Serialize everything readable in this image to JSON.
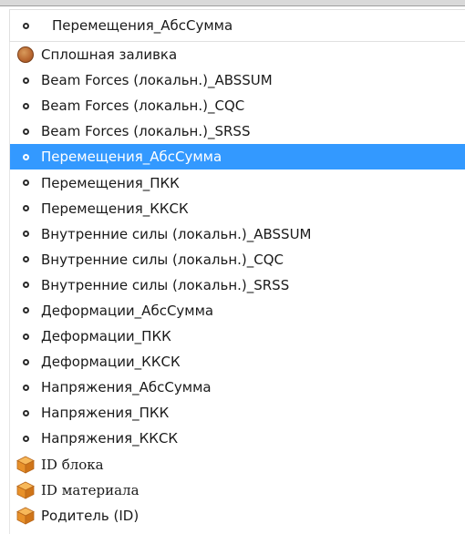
{
  "combo": {
    "value": "Перемещения_АбсСумма",
    "icon": "ring-icon"
  },
  "items": [
    {
      "label": "Сплошная заливка",
      "icon": "filled-circle-icon"
    },
    {
      "label": "Beam Forces (локальн.)_ABSSUM",
      "icon": "ring-icon"
    },
    {
      "label": "Beam Forces (локальн.)_CQC",
      "icon": "ring-icon"
    },
    {
      "label": "Beam Forces (локальн.)_SRSS",
      "icon": "ring-icon"
    },
    {
      "label": "Перемещения_АбсСумма",
      "icon": "ring-icon",
      "selected": true
    },
    {
      "label": "Перемещения_ПКК",
      "icon": "ring-icon"
    },
    {
      "label": "Перемещения_ККСК",
      "icon": "ring-icon"
    },
    {
      "label": "Внутренние силы (локальн.)_ABSSUM",
      "icon": "ring-icon"
    },
    {
      "label": "Внутренние силы (локальн.)_CQC",
      "icon": "ring-icon"
    },
    {
      "label": "Внутренние силы (локальн.)_SRSS",
      "icon": "ring-icon"
    },
    {
      "label": "Деформации_АбсСумма",
      "icon": "ring-icon"
    },
    {
      "label": "Деформации_ПКК",
      "icon": "ring-icon"
    },
    {
      "label": "Деформации_ККСК",
      "icon": "ring-icon"
    },
    {
      "label": "Напряжения_АбсСумма",
      "icon": "ring-icon"
    },
    {
      "label": "Напряжения_ПКК",
      "icon": "ring-icon"
    },
    {
      "label": "Напряжения_ККСК",
      "icon": "ring-icon"
    },
    {
      "label": "ID блока",
      "icon": "cube-icon"
    },
    {
      "label": "ID материала",
      "icon": "cube-icon"
    },
    {
      "label": "Родитель (ID)",
      "icon": "cube-icon"
    }
  ],
  "colors": {
    "selection": "#3399ff",
    "cube": "#e8912a",
    "filled_circle": "#b8662f"
  }
}
